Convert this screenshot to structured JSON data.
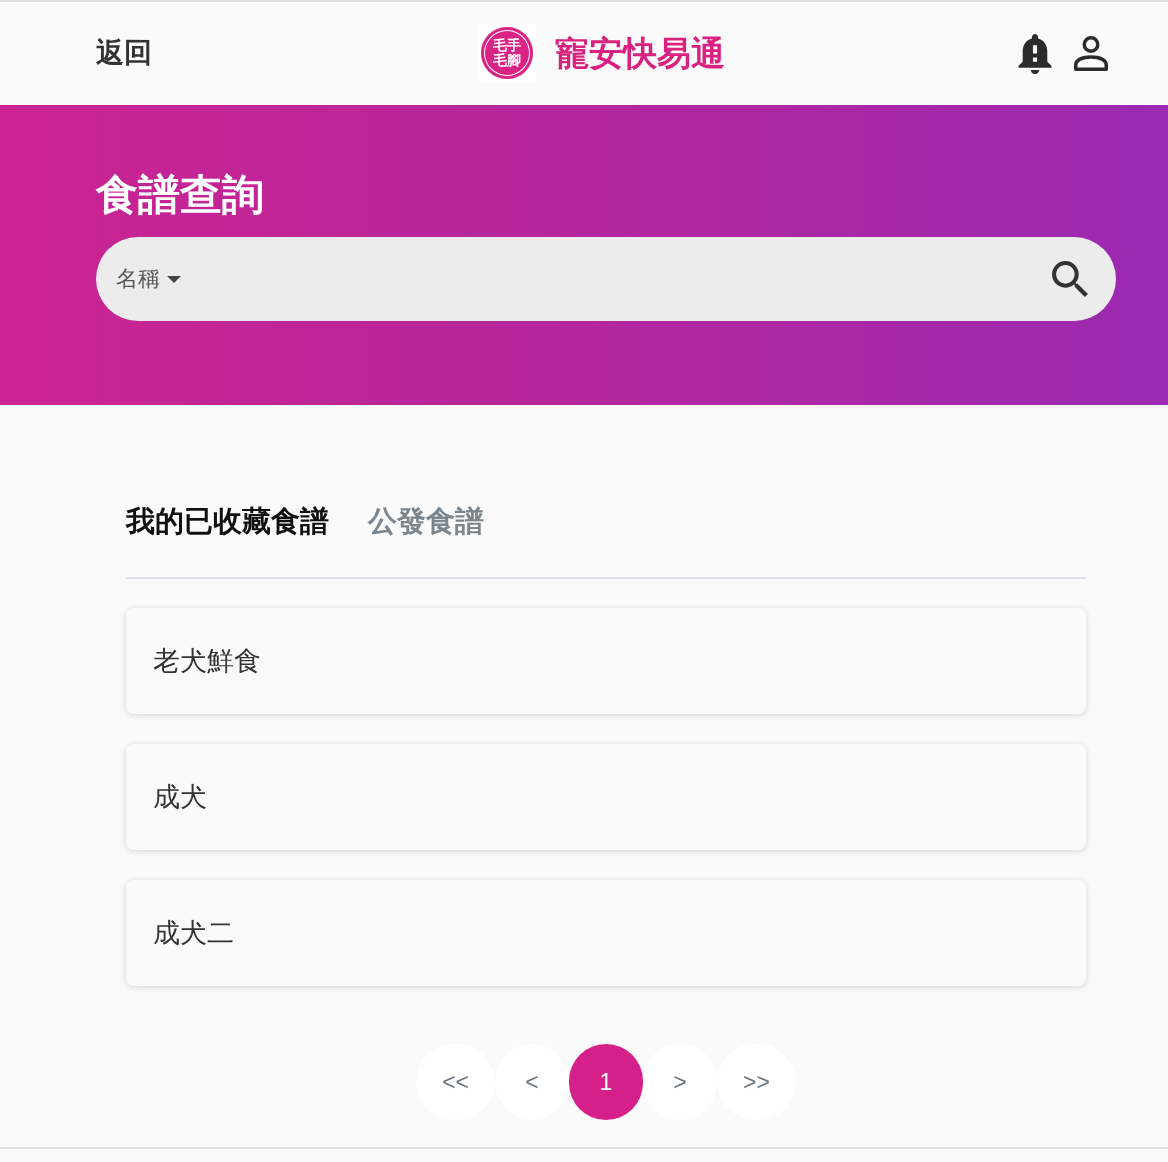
{
  "header": {
    "back_link": "返回",
    "logo": {
      "lines": [
        "毛手",
        "毛腳"
      ]
    },
    "brand_title": "寵安快易通"
  },
  "banner": {
    "title": "食譜查詢",
    "search": {
      "filter": "名稱"
    }
  },
  "tabs": [
    {
      "label": "我的已收藏食譜",
      "selected": true
    },
    {
      "label": "公發食譜",
      "selected": false
    }
  ],
  "recipes": [
    "老犬鮮食",
    "成犬",
    "成犬二"
  ],
  "pagination": [
    {
      "label": "<<",
      "selected": false
    },
    {
      "label": "<",
      "selected": false
    },
    {
      "label": "1",
      "selected": true
    },
    {
      "label": ">",
      "selected": false
    },
    {
      "label": ">>",
      "selected": false
    }
  ]
}
